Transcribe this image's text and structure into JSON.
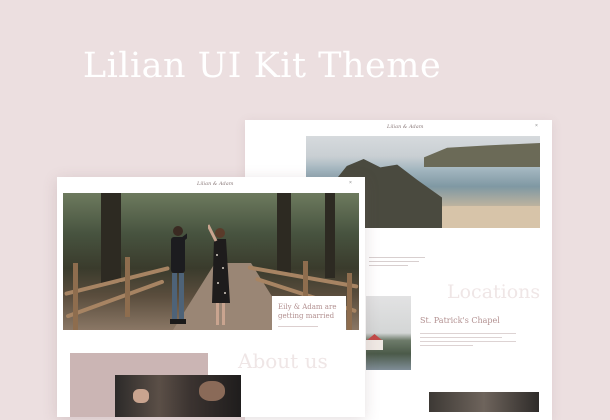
{
  "hero": {
    "title": "Lilian UI Kit Theme"
  },
  "back_page": {
    "logo": "Lilian & Adam",
    "close_icon": "×",
    "locations_heading": "Locations",
    "location_name": "St. Patrick's Chapel"
  },
  "front_page": {
    "logo": "Lilian & Adam",
    "close_icon": "×",
    "card_title": "Eily & Adam are getting married",
    "about_heading": "About us"
  },
  "colors": {
    "background": "#ecdfe0",
    "accent": "#b29090",
    "block": "#cbb5b4"
  }
}
